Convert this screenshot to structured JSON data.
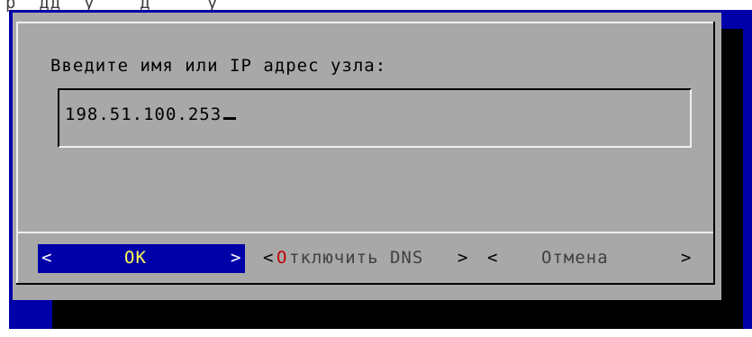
{
  "terminal": {
    "top_text": "р  дд  у    д     у",
    "colors": {
      "screen_background": "#0000a8",
      "dialog_background": "#a8a8a8",
      "selected_button_background": "#0000a8",
      "selected_button_text": "#ffff55",
      "hotkey_color": "#c00000"
    }
  },
  "dialog": {
    "prompt": "Введите имя или IP адрес узла:",
    "input": {
      "value": "198.51.100.253"
    },
    "buttons": {
      "ok": {
        "bracket_left": "<",
        "label": "OK",
        "bracket_right": ">"
      },
      "disable_dns": {
        "bracket_left": "<",
        "hotkey": "О",
        "label": "тключить DNS",
        "bracket_right": ">"
      },
      "cancel": {
        "bracket_left": "<",
        "label": "Отмена",
        "bracket_right": ">"
      }
    }
  }
}
